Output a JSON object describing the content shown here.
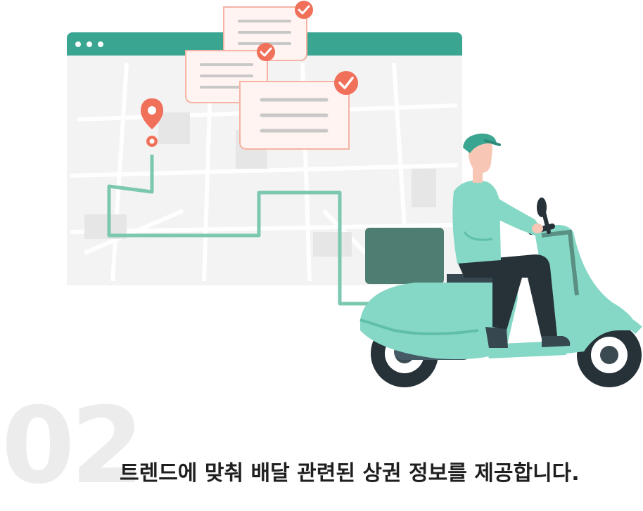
{
  "section": {
    "number": "02",
    "caption": "트렌드에 맞춰 배달 관련된 상권 정보를 제공합니다."
  },
  "colors": {
    "accent": "#3aa591",
    "route": "#7cc7b0",
    "pin": "#f0705a",
    "scooter": "#86d8c6",
    "card_border": "#f6b3a4"
  },
  "icons": [
    "window-dots-icon",
    "map-pin-icon",
    "check-icon",
    "delivery-scooter-icon"
  ]
}
